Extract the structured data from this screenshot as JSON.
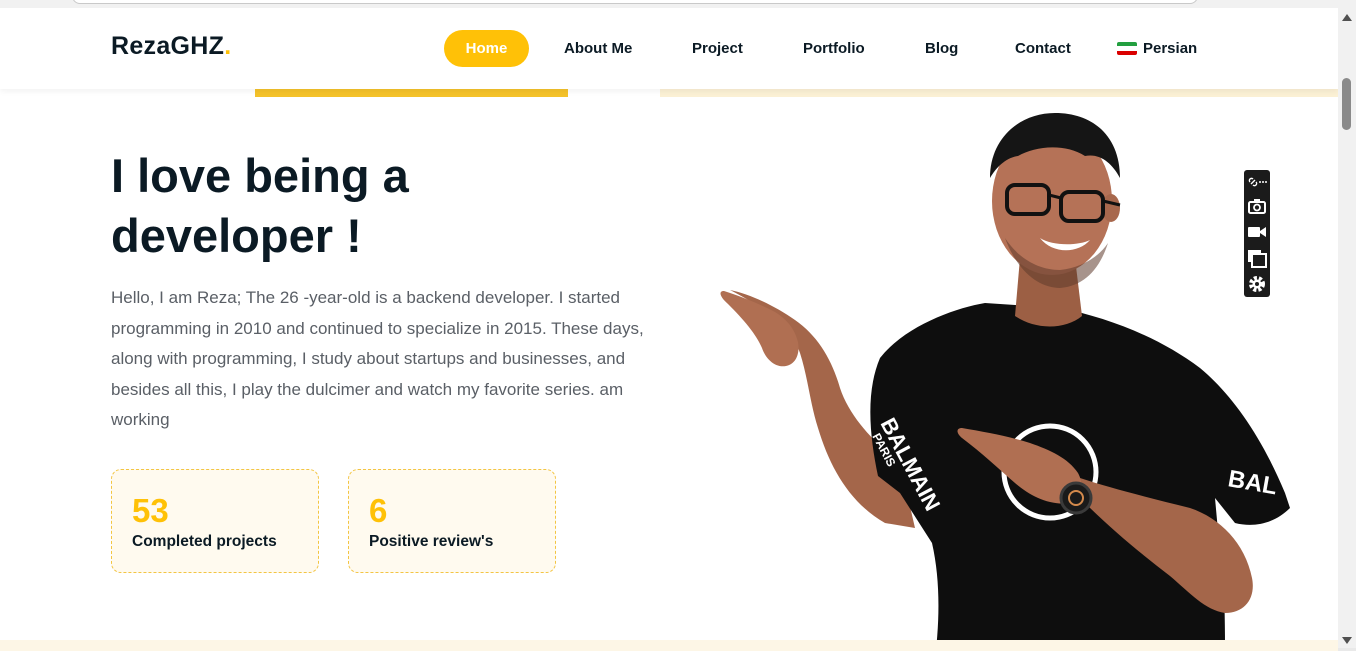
{
  "header": {
    "logo_text": "RezaGHZ",
    "logo_dot": ".",
    "nav": [
      {
        "label": "Home",
        "active": true
      },
      {
        "label": "About Me"
      },
      {
        "label": "Project"
      },
      {
        "label": "Portfolio"
      },
      {
        "label": "Blog"
      },
      {
        "label": "Contact"
      },
      {
        "label": "Persian",
        "icon": "iran-flag-icon"
      }
    ]
  },
  "hero": {
    "title_line1": "I love being a",
    "title_line2": "developer !",
    "description": "Hello, I am Reza; The 26 -year-old is a backend developer. I started programming in 2010 and continued to specialize in 2015. These days, along with programming, I study about startups and businesses, and besides all this, I play the dulcimer and watch my favorite series. am working",
    "stats": [
      {
        "value": "53",
        "label": "Completed projects"
      },
      {
        "value": "6",
        "label": "Positive review's"
      }
    ],
    "shirt_text_sleeve": "BALMAIN",
    "shirt_text_sleeve_sub": "PARIS",
    "shirt_text_side": "BAL"
  },
  "toolbar": {
    "icons": [
      "link-icon",
      "more-icon",
      "camera-icon",
      "video-icon",
      "window-icon",
      "gear-icon"
    ]
  },
  "colors": {
    "accent": "#ffc107",
    "dark_text": "#0b1a24",
    "body_text": "#5a5f66",
    "card_bg": "#fffaef"
  }
}
